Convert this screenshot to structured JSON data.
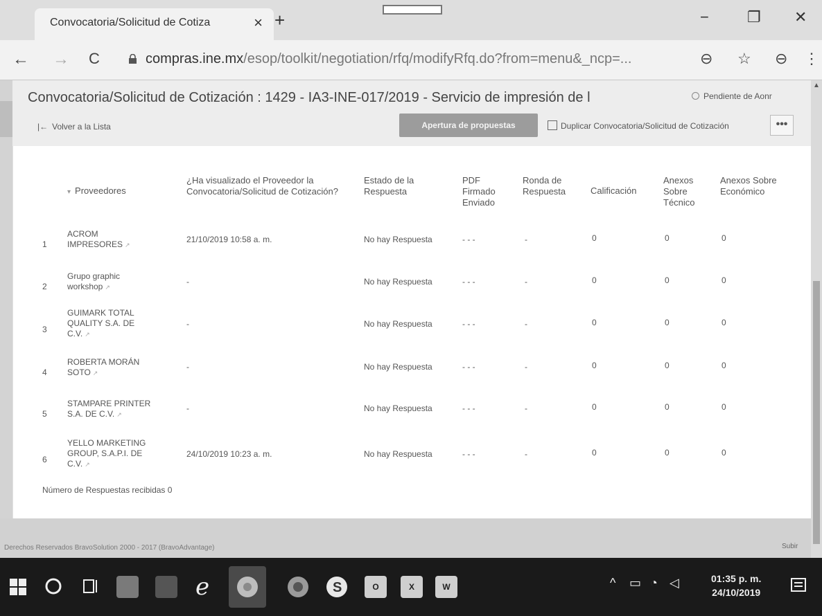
{
  "browser": {
    "tab_title": "Convocatoria/Solicitud de Cotiza",
    "tab_close": "×",
    "new_tab": "+",
    "url_domain": "compras.ine.mx",
    "url_path": "/esop/toolkit/negotiation/rfq/modifyRfq.do?from=menu&_ncp=...",
    "window": {
      "minimize": "−",
      "restore": "❐",
      "close": "✕"
    },
    "nav": {
      "back": "←",
      "forward": "→",
      "reload": "C"
    },
    "icons": {
      "zoom": "⊖",
      "star": "☆",
      "profile": "⊖",
      "menu": "⋮"
    }
  },
  "header": {
    "title": "Convocatoria/Solicitud de Cotización : 1429 - IA3-INE-017/2019 - Servicio de impresión de l",
    "status": "Pendiente de Aonr",
    "back_label": "Volver a la Lista",
    "open_button": "Apertura de propuestas",
    "duplicate_button": "Duplicar Convocatoria/Solicitud de Cotización",
    "more_button": "•••"
  },
  "table": {
    "headers": {
      "proveedores": "Proveedores",
      "visualizado": "¿Ha visualizado el Proveedor la Convocatoria/Solicitud de Cotización?",
      "estado": "Estado de la Respuesta",
      "pdf": "PDF Firmado Enviado",
      "ronda": "Ronda de Respuesta",
      "calificacion": "Calificación",
      "anexos_tecnico": "Anexos Sobre Técnico",
      "anexos_economico": "Anexos Sobre Económico"
    },
    "rows": [
      {
        "num": "1",
        "proveedor": "ACROM IMPRESORES",
        "visualizado": "21/10/2019 10:58 a. m.",
        "estado": "No hay Respuesta",
        "pdf": "- - -",
        "ronda": "-",
        "calificacion": "0",
        "anexos_tecnico": "0",
        "anexos_economico": "0"
      },
      {
        "num": "2",
        "proveedor": "Grupo graphic workshop",
        "visualizado": "-",
        "estado": "No hay Respuesta",
        "pdf": "- - -",
        "ronda": "-",
        "calificacion": "0",
        "anexos_tecnico": "0",
        "anexos_economico": "0"
      },
      {
        "num": "3",
        "proveedor": "GUIMARK TOTAL QUALITY S.A. DE C.V.",
        "visualizado": "-",
        "estado": "No hay Respuesta",
        "pdf": "- - -",
        "ronda": "-",
        "calificacion": "0",
        "anexos_tecnico": "0",
        "anexos_economico": "0"
      },
      {
        "num": "4",
        "proveedor": "ROBERTA MORÁN SOTO",
        "visualizado": "-",
        "estado": "No hay Respuesta",
        "pdf": "- - -",
        "ronda": "-",
        "calificacion": "0",
        "anexos_tecnico": "0",
        "anexos_economico": "0"
      },
      {
        "num": "5",
        "proveedor": "STAMPARE PRINTER S.A. DE C.V.",
        "visualizado": "-",
        "estado": "No hay Respuesta",
        "pdf": "- - -",
        "ronda": "-",
        "calificacion": "0",
        "anexos_tecnico": "0",
        "anexos_economico": "0"
      },
      {
        "num": "6",
        "proveedor": "YELLO MARKETING GROUP, S.A.P.I. DE C.V.",
        "visualizado": "24/10/2019 10:23 a. m.",
        "estado": "No hay Respuesta",
        "pdf": "- - -",
        "ronda": "-",
        "calificacion": "0",
        "anexos_tecnico": "0",
        "anexos_economico": "0"
      }
    ],
    "responses_received": "Número de Respuestas recibidas 0"
  },
  "footer": {
    "copyright": "Derechos Reservados BravoSolution 2000 - 2017 (BravoAdvantage)",
    "scroll_top": "Subir"
  },
  "taskbar": {
    "clock_time": "01:35 p. m.",
    "clock_date": "24/10/2019",
    "apps": [
      "windows-start",
      "search",
      "task-view",
      "file-explorer",
      "media-player",
      "internet-explorer",
      "chrome",
      "firefox",
      "skype",
      "outlook",
      "excel",
      "word"
    ],
    "colors": {
      "excel": "#1e7145",
      "word": "#2b579a",
      "outlook": "#0072c6",
      "skype": "#00aff0"
    }
  }
}
